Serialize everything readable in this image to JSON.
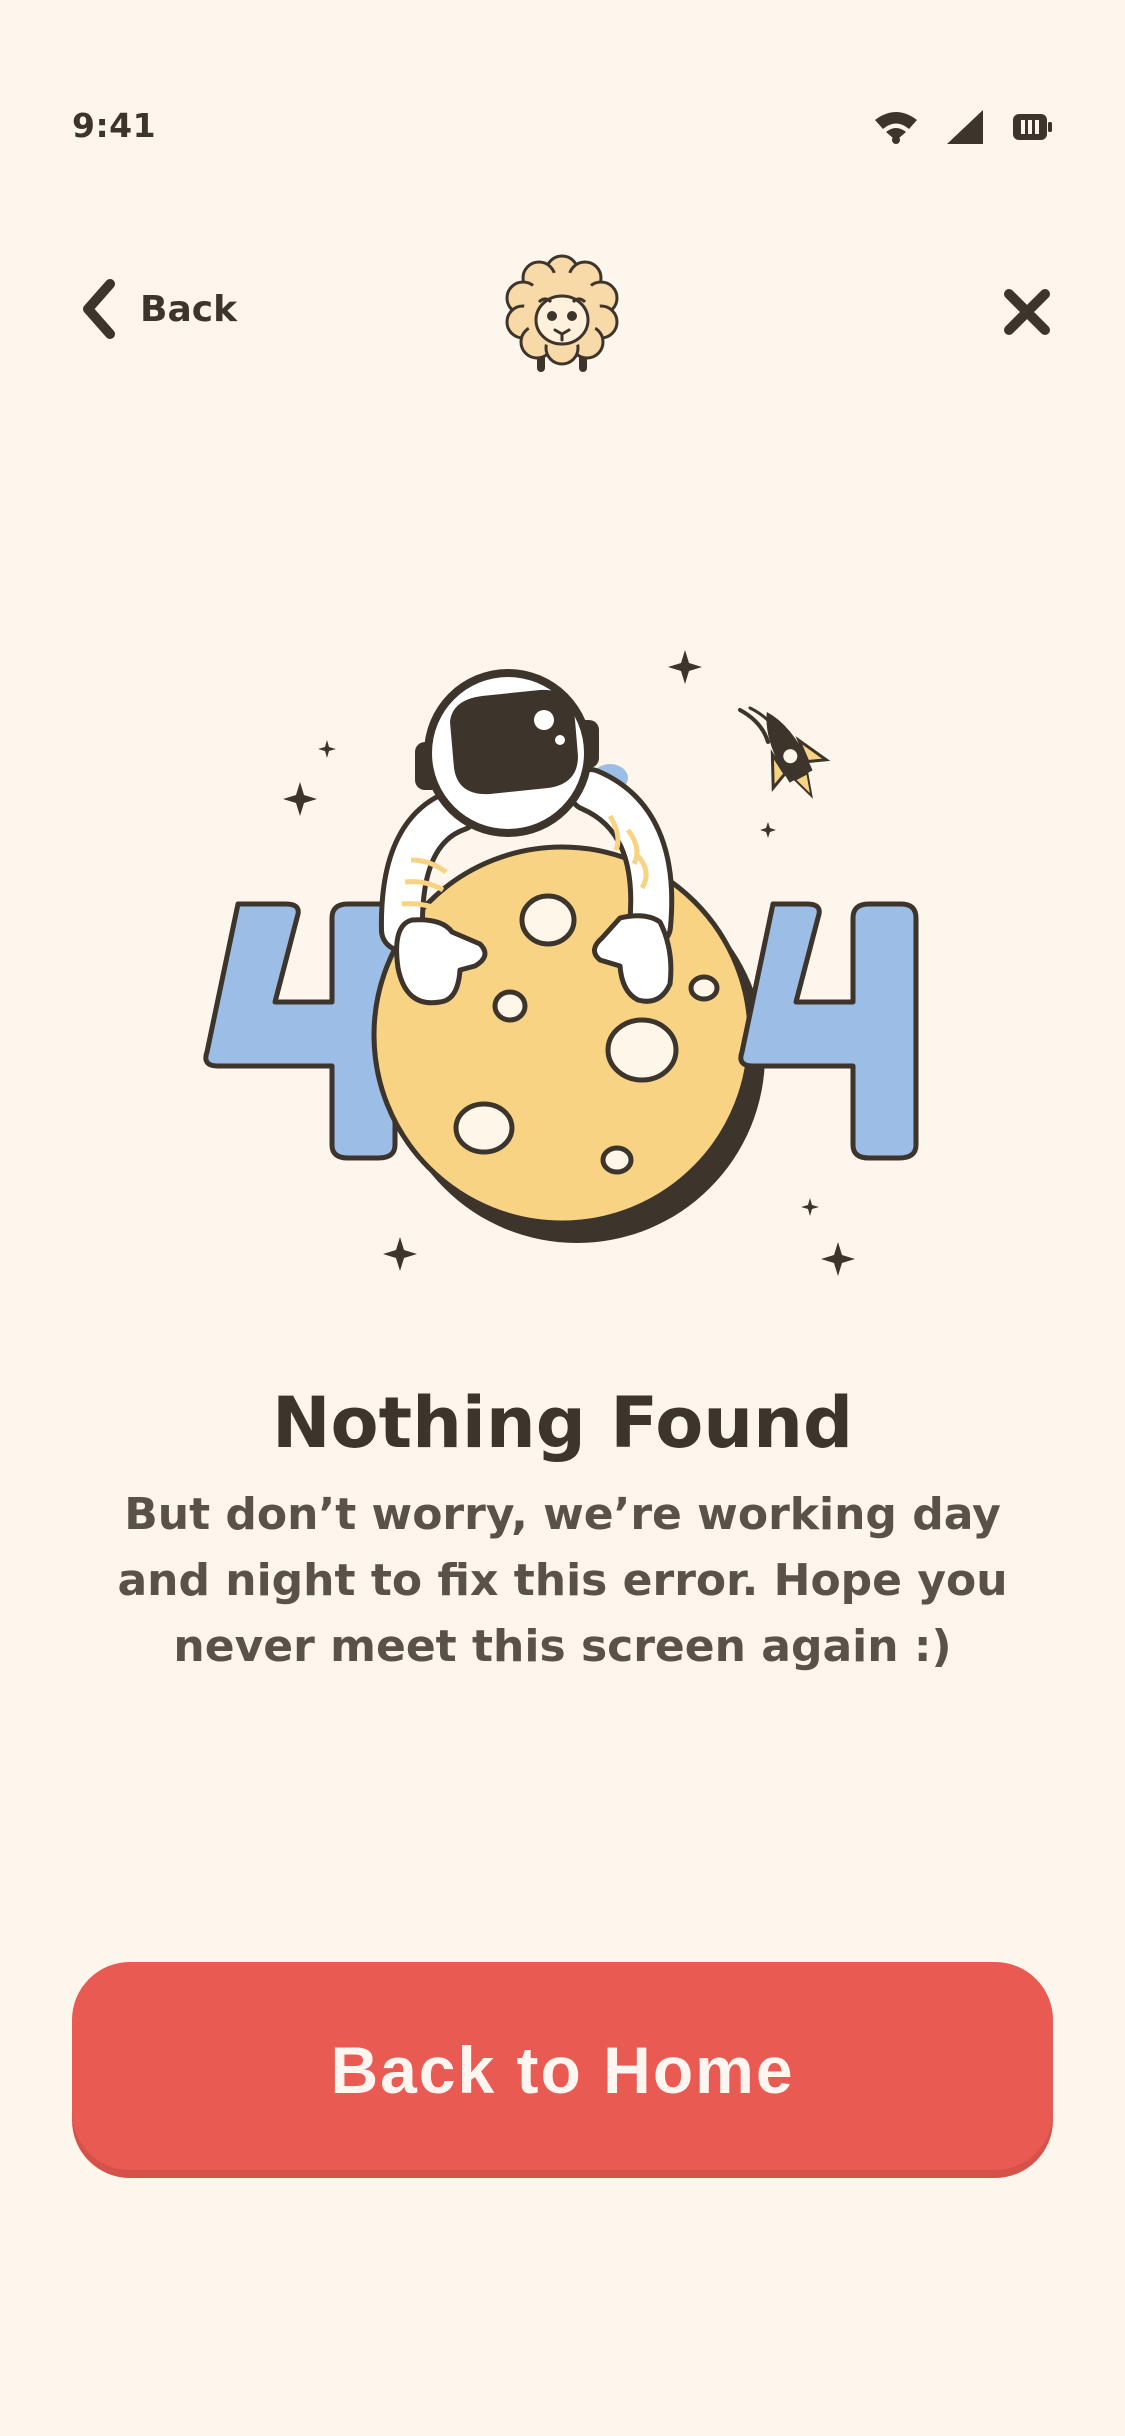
{
  "status_bar": {
    "time": "9:41",
    "icons": [
      "wifi-icon",
      "cellular-signal-icon",
      "battery-icon"
    ]
  },
  "nav": {
    "back_label": "Back",
    "back_icon": "chevron-left-icon",
    "logo": "sheep-logo-icon",
    "close_icon": "close-icon"
  },
  "illustration": {
    "text": "404",
    "subject": "astronaut-on-moon"
  },
  "content": {
    "title": "Nothing Found",
    "description": "But don’t worry, we’re working day and night to fix this error. Hope you never meet this screen again :)"
  },
  "actions": {
    "primary_label": "Back to Home"
  },
  "colors": {
    "background": "#FDF6EC",
    "text_primary": "#3D342C",
    "text_secondary": "#5A514A",
    "accent": "#E85A52",
    "digit_blue": "#9BBDE6",
    "moon_yellow": "#F8D384"
  }
}
